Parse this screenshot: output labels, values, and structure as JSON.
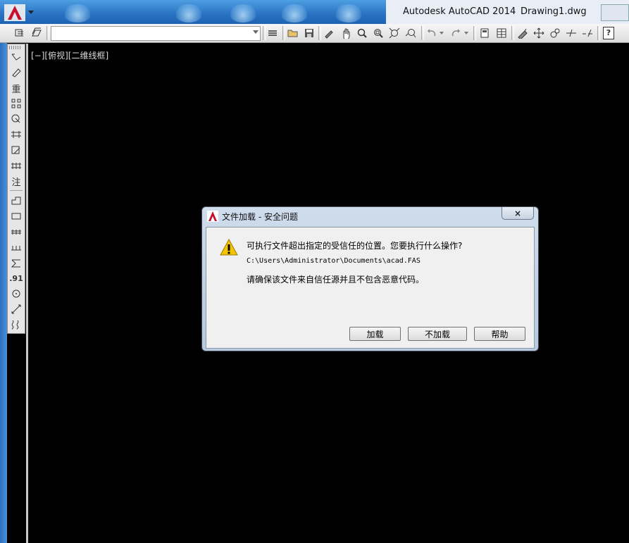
{
  "window": {
    "app_title": "Autodesk AutoCAD 2014",
    "document_title": "Drawing1.dwg"
  },
  "toolbar": {
    "layer_combo_value": "",
    "help_label": "?"
  },
  "viewport": {
    "label": "[−][俯视][二维线框]"
  },
  "left_toolbar": {
    "items": [
      "重",
      "注",
      ".91"
    ]
  },
  "dialog": {
    "title": "文件加载 - 安全问题",
    "close_label": "×",
    "message": "可执行文件超出指定的受信任的位置。您要执行什么操作?",
    "path": "C:\\Users\\Administrator\\Documents\\acad.FAS",
    "hint": "请确保该文件来自信任源并且不包含恶意代码。",
    "buttons": {
      "load": "加载",
      "dont_load": "不加载",
      "help": "帮助"
    }
  },
  "colors": {
    "drawing_background": "#000000",
    "accent_red": "#c8102e",
    "warning_yellow": "#f5c400"
  }
}
